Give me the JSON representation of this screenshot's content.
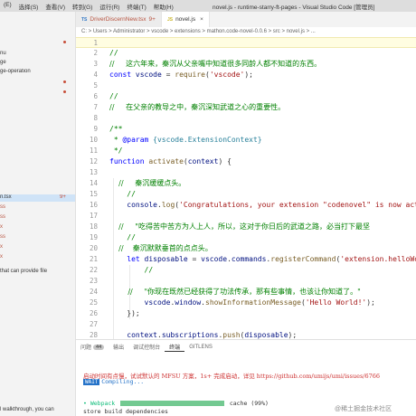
{
  "titlebar": {
    "menu": [
      "(E)",
      "选择(S)",
      "查看(V)",
      "转到(G)",
      "运行(R)",
      "终端(T)",
      "帮助(H)"
    ],
    "title": "novel.js - runtime-starry-ft-pages - Visual Studio Code [管理员]"
  },
  "sidebar": {
    "rows": [
      {
        "text": "nu",
        "dot": false
      },
      {
        "text": "ge",
        "dot": false
      },
      {
        "text": "ge-operation",
        "dot": false
      }
    ],
    "files": [
      {
        "text": "n.tsx",
        "badge": "9+"
      },
      {
        "text": "ss"
      },
      {
        "text": "ss"
      },
      {
        "text": "x"
      },
      {
        "text": "ss"
      },
      {
        "text": "x"
      },
      {
        "text": "x"
      }
    ],
    "hint1": "that can provide file",
    "hint2": "l walkthrough, you can"
  },
  "tabs": [
    {
      "icon": "TS",
      "label": "DriverDiscernNew.tsx",
      "badge": "9+",
      "active": false
    },
    {
      "icon": "JS",
      "label": "novel.js",
      "close": "×",
      "active": true
    }
  ],
  "breadcrumb": "C: > Users > Administrator > vscode > extensions > mathon.code-novel-0.0.6 > src > novel.js > ...",
  "editor": {
    "lines": [
      {
        "n": "1",
        "parts": []
      },
      {
        "n": "2",
        "parts": [
          {
            "c": "com",
            "t": "//"
          }
        ]
      },
      {
        "n": "3",
        "parts": [
          {
            "c": "com",
            "t": "//     这六年来，秦沉从父亲嘴中知道很多同龄人都不知道的东西。"
          }
        ]
      },
      {
        "n": "4",
        "parts": [
          {
            "c": "kw",
            "t": "const "
          },
          {
            "c": "var",
            "t": "vscode"
          },
          {
            "c": "def",
            "t": " = "
          },
          {
            "c": "fn",
            "t": "require"
          },
          {
            "c": "def",
            "t": "("
          },
          {
            "c": "str",
            "t": "'vscode'"
          },
          {
            "c": "def",
            "t": ");"
          }
        ]
      },
      {
        "n": "5",
        "parts": []
      },
      {
        "n": "6",
        "parts": [
          {
            "c": "com",
            "t": "//"
          }
        ]
      },
      {
        "n": "7",
        "parts": [
          {
            "c": "com",
            "t": "//     在父亲的教导之中，秦沉深知武道之心的重要性。"
          }
        ]
      },
      {
        "n": "8",
        "parts": []
      },
      {
        "n": "9",
        "parts": [
          {
            "c": "com",
            "t": "/**"
          }
        ]
      },
      {
        "n": "10",
        "parts": [
          {
            "c": "com",
            "t": " * "
          },
          {
            "c": "kw",
            "t": "@param "
          },
          {
            "c": "type",
            "t": "{vscode.ExtensionContext}"
          }
        ]
      },
      {
        "n": "11",
        "parts": [
          {
            "c": "com",
            "t": " */"
          }
        ]
      },
      {
        "n": "12",
        "parts": [
          {
            "c": "kw",
            "t": "function "
          },
          {
            "c": "fn",
            "t": "activate"
          },
          {
            "c": "def",
            "t": "("
          },
          {
            "c": "var",
            "t": "context"
          },
          {
            "c": "def",
            "t": ") {"
          }
        ]
      },
      {
        "n": "13",
        "parts": []
      },
      {
        "n": "14",
        "parts": [
          {
            "c": "com",
            "t": "    //     秦沉缓缓点头。"
          }
        ]
      },
      {
        "n": "15",
        "parts": [
          {
            "c": "com",
            "t": "    //"
          }
        ]
      },
      {
        "n": "16",
        "parts": [
          {
            "c": "def",
            "t": "    "
          },
          {
            "c": "var",
            "t": "console"
          },
          {
            "c": "def",
            "t": "."
          },
          {
            "c": "fn",
            "t": "log"
          },
          {
            "c": "def",
            "t": "("
          },
          {
            "c": "str",
            "t": "'Congratulations, your extension \"codenovel\" is now act"
          }
        ]
      },
      {
        "n": "17",
        "parts": []
      },
      {
        "n": "18",
        "parts": [
          {
            "c": "com",
            "t": "    //     \"吃得苦中苦方为人上人，所以，这对于你日后的武道之路，必当打下最坚"
          }
        ]
      },
      {
        "n": "19",
        "parts": [
          {
            "c": "com",
            "t": "    //"
          }
        ]
      },
      {
        "n": "20",
        "parts": [
          {
            "c": "com",
            "t": "    //    秦沉默默垂首的点点头。"
          }
        ]
      },
      {
        "n": "21",
        "parts": [
          {
            "c": "def",
            "t": "    "
          },
          {
            "c": "kw",
            "t": "let "
          },
          {
            "c": "var",
            "t": "disposable"
          },
          {
            "c": "def",
            "t": " = "
          },
          {
            "c": "var",
            "t": "vscode"
          },
          {
            "c": "def",
            "t": "."
          },
          {
            "c": "var",
            "t": "commands"
          },
          {
            "c": "def",
            "t": "."
          },
          {
            "c": "fn",
            "t": "registerCommand"
          },
          {
            "c": "def",
            "t": "("
          },
          {
            "c": "str",
            "t": "'extension.helloWo"
          }
        ]
      },
      {
        "n": "22",
        "parts": [
          {
            "c": "com",
            "t": "        //"
          }
        ]
      },
      {
        "n": "23",
        "parts": []
      },
      {
        "n": "24",
        "parts": [
          {
            "c": "com",
            "t": "        //     \"你现在既然已经获得了功法传承，那有些事情，也该让你知道了。\""
          }
        ]
      },
      {
        "n": "25",
        "parts": [
          {
            "c": "def",
            "t": "        "
          },
          {
            "c": "var",
            "t": "vscode"
          },
          {
            "c": "def",
            "t": "."
          },
          {
            "c": "var",
            "t": "window"
          },
          {
            "c": "def",
            "t": "."
          },
          {
            "c": "fn",
            "t": "showInformationMessage"
          },
          {
            "c": "def",
            "t": "("
          },
          {
            "c": "str",
            "t": "'Hello World!'"
          },
          {
            "c": "def",
            "t": ");"
          }
        ]
      },
      {
        "n": "26",
        "parts": [
          {
            "c": "def",
            "t": "    });"
          }
        ]
      },
      {
        "n": "27",
        "parts": []
      },
      {
        "n": "28",
        "parts": [
          {
            "c": "def",
            "t": "    "
          },
          {
            "c": "var",
            "t": "context"
          },
          {
            "c": "def",
            "t": "."
          },
          {
            "c": "var",
            "t": "subscriptions"
          },
          {
            "c": "def",
            "t": "."
          },
          {
            "c": "fn",
            "t": "push"
          },
          {
            "c": "def",
            "t": "("
          },
          {
            "c": "var",
            "t": "disposable"
          },
          {
            "c": "def",
            "t": ");"
          }
        ]
      },
      {
        "n": "29",
        "parts": []
      }
    ]
  },
  "panel": {
    "tabs": [
      {
        "label": "问题",
        "count": "44"
      },
      {
        "label": "输出"
      },
      {
        "label": "调试控制台"
      },
      {
        "label": "终端",
        "active": true
      },
      {
        "label": "GITLENS"
      }
    ],
    "terminal": {
      "line1": "启动时间有点慢，试试默认的 MFSU 方案，1s+ 完成启动，详见 https://github.com/umijs/umi/issues/6766",
      "wait": "WAIT",
      "compiling": "Compiling...",
      "webpack_label": "• Webpack",
      "cache": "cache (99%)",
      "store": "store build dependencies"
    }
  },
  "watermark": "@稀土掘金技术社区"
}
